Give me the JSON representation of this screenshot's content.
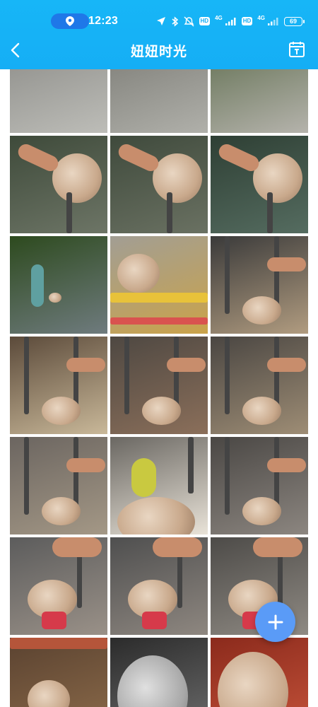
{
  "status_bar": {
    "time": "12:23",
    "network_1": "4G",
    "network_2": "4G",
    "hd_1": "HD",
    "hd_2": "HD",
    "battery": "69"
  },
  "header": {
    "title": "妞妞时光"
  },
  "colors": {
    "accent": "#15aef5",
    "fab": "#5a9bf7"
  },
  "photos": [
    {
      "scene": "street-walk",
      "bg": [
        "#8a8a86",
        "#bdbdb8"
      ]
    },
    {
      "scene": "street-walk",
      "bg": [
        "#7a7a74",
        "#b0b0aa"
      ]
    },
    {
      "scene": "street-walk",
      "bg": [
        "#5e6d4e",
        "#b5b3ac"
      ]
    },
    {
      "scene": "held-puppy",
      "bg": [
        "#3e4a3a",
        "#6d7566"
      ]
    },
    {
      "scene": "held-puppy",
      "bg": [
        "#3f4a3c",
        "#6a7162"
      ]
    },
    {
      "scene": "held-puppy",
      "bg": [
        "#2e3f34",
        "#556c60"
      ]
    },
    {
      "scene": "road-walk",
      "bg": [
        "#2d4a1e",
        "#6f7b7e"
      ]
    },
    {
      "scene": "yellow-toy",
      "bg": [
        "#a29e94",
        "#caa34a"
      ]
    },
    {
      "scene": "under-table",
      "bg": [
        "#3a3a3a",
        "#b19c80"
      ]
    },
    {
      "scene": "under-table",
      "bg": [
        "#5b4a3a",
        "#c9b899"
      ]
    },
    {
      "scene": "under-table",
      "bg": [
        "#4e4842",
        "#8b6f5a"
      ]
    },
    {
      "scene": "under-table",
      "bg": [
        "#4a4642",
        "#9e8d75"
      ]
    },
    {
      "scene": "under-table",
      "bg": [
        "#6b6560",
        "#a49886"
      ]
    },
    {
      "scene": "face-up",
      "bg": [
        "#6a6762",
        "#e9e3d8"
      ]
    },
    {
      "scene": "sitting",
      "bg": [
        "#4a4744",
        "#8c8680"
      ]
    },
    {
      "scene": "sitting-red",
      "bg": [
        "#5c5c5c",
        "#9a9188"
      ]
    },
    {
      "scene": "sitting-red",
      "bg": [
        "#4f4f4f",
        "#8e8780"
      ]
    },
    {
      "scene": "sitting-red",
      "bg": [
        "#4d4b48",
        "#8f8a83"
      ]
    },
    {
      "scene": "table-top",
      "bg": [
        "#5a4230",
        "#8c6b4a"
      ]
    },
    {
      "scene": "grey-portrait",
      "bg": [
        "#2b2b2b",
        "#6d6d6d"
      ]
    },
    {
      "scene": "red-bg-portrait",
      "bg": [
        "#8b2a1c",
        "#c5533a"
      ]
    }
  ]
}
